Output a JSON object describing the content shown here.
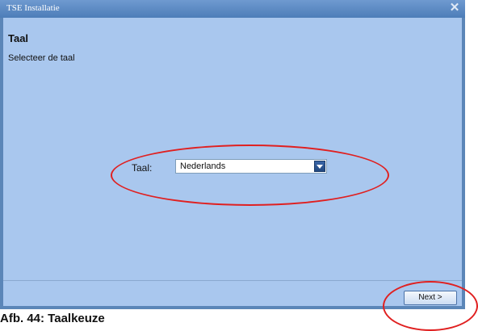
{
  "window": {
    "title": "TSE Installatie"
  },
  "header": {
    "heading": "Taal",
    "subheading": "Selecteer de taal"
  },
  "language": {
    "label": "Taal:",
    "selected": "Nederlands"
  },
  "footer": {
    "next_label": "Next >"
  },
  "caption": "Afb. 44: Taalkeuze",
  "colors": {
    "window_bg": "#a9c7ee",
    "titlebar": "#4d7db8",
    "highlight": "#e02020"
  }
}
